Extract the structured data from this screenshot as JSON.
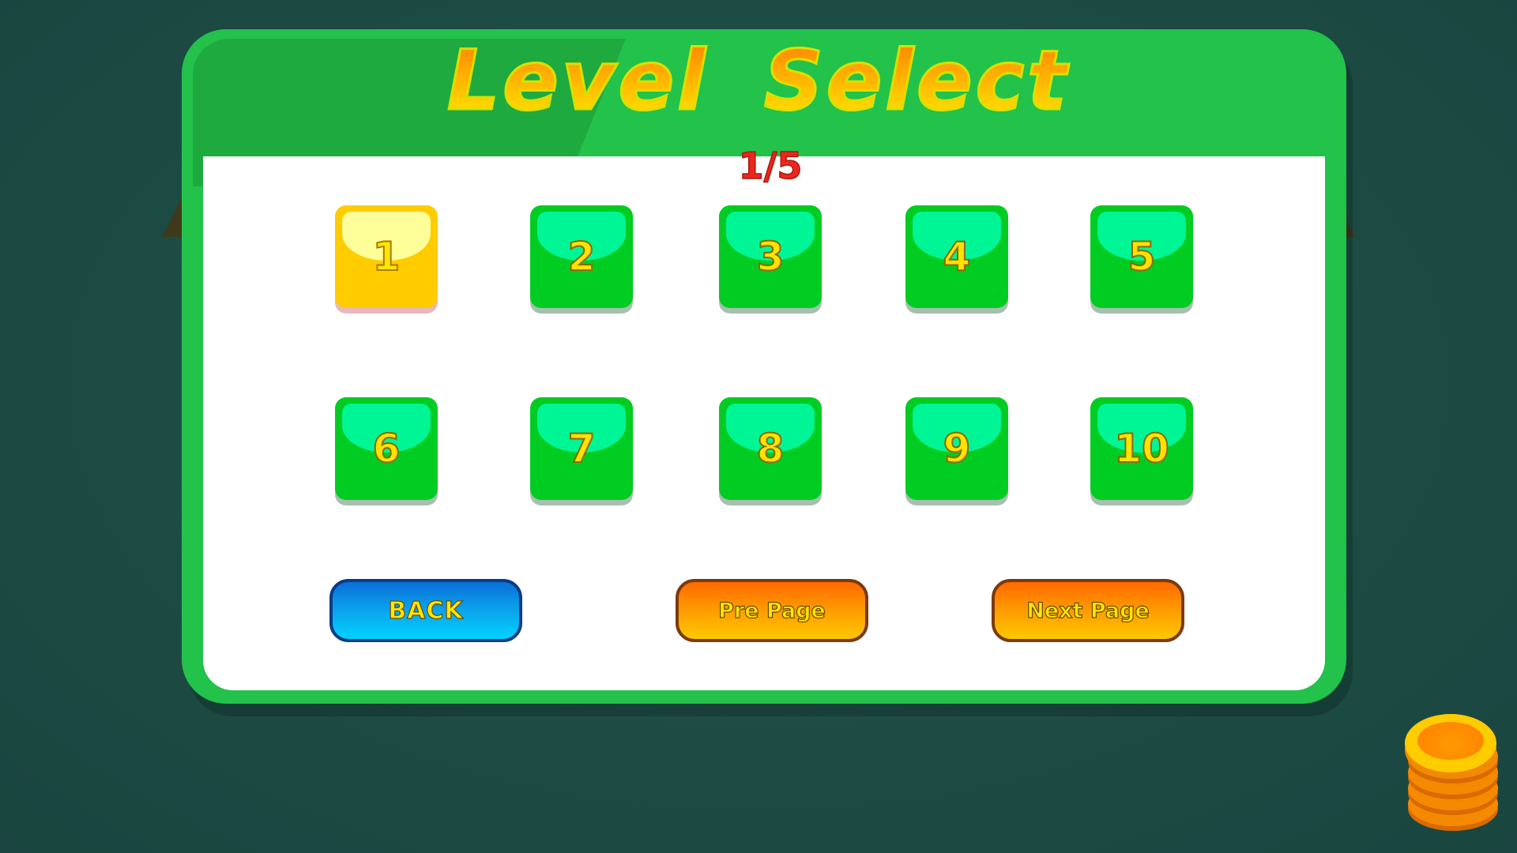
{
  "header": {
    "title": "Level Select",
    "page_indicator": "1/5"
  },
  "levels": [
    {
      "label": "1",
      "current": true
    },
    {
      "label": "2",
      "current": false
    },
    {
      "label": "3",
      "current": false
    },
    {
      "label": "4",
      "current": false
    },
    {
      "label": "5",
      "current": false
    },
    {
      "label": "6",
      "current": false
    },
    {
      "label": "7",
      "current": false
    },
    {
      "label": "8",
      "current": false
    },
    {
      "label": "9",
      "current": false
    },
    {
      "label": "10",
      "current": false
    }
  ],
  "buttons": {
    "back_label": "BACK",
    "pre_label": "Pre Page",
    "next_label": "Next Page"
  },
  "icons": {
    "coin_stack": "coin-stack-icon"
  },
  "colors": {
    "background": "#1f4d45",
    "panel": "#22c24b",
    "tile": "#00cc22",
    "tile_current": "#ffcc00",
    "page_indicator": "#e8281f",
    "back_button": "#0aa9ee",
    "page_buttons": "#ff9c00"
  }
}
